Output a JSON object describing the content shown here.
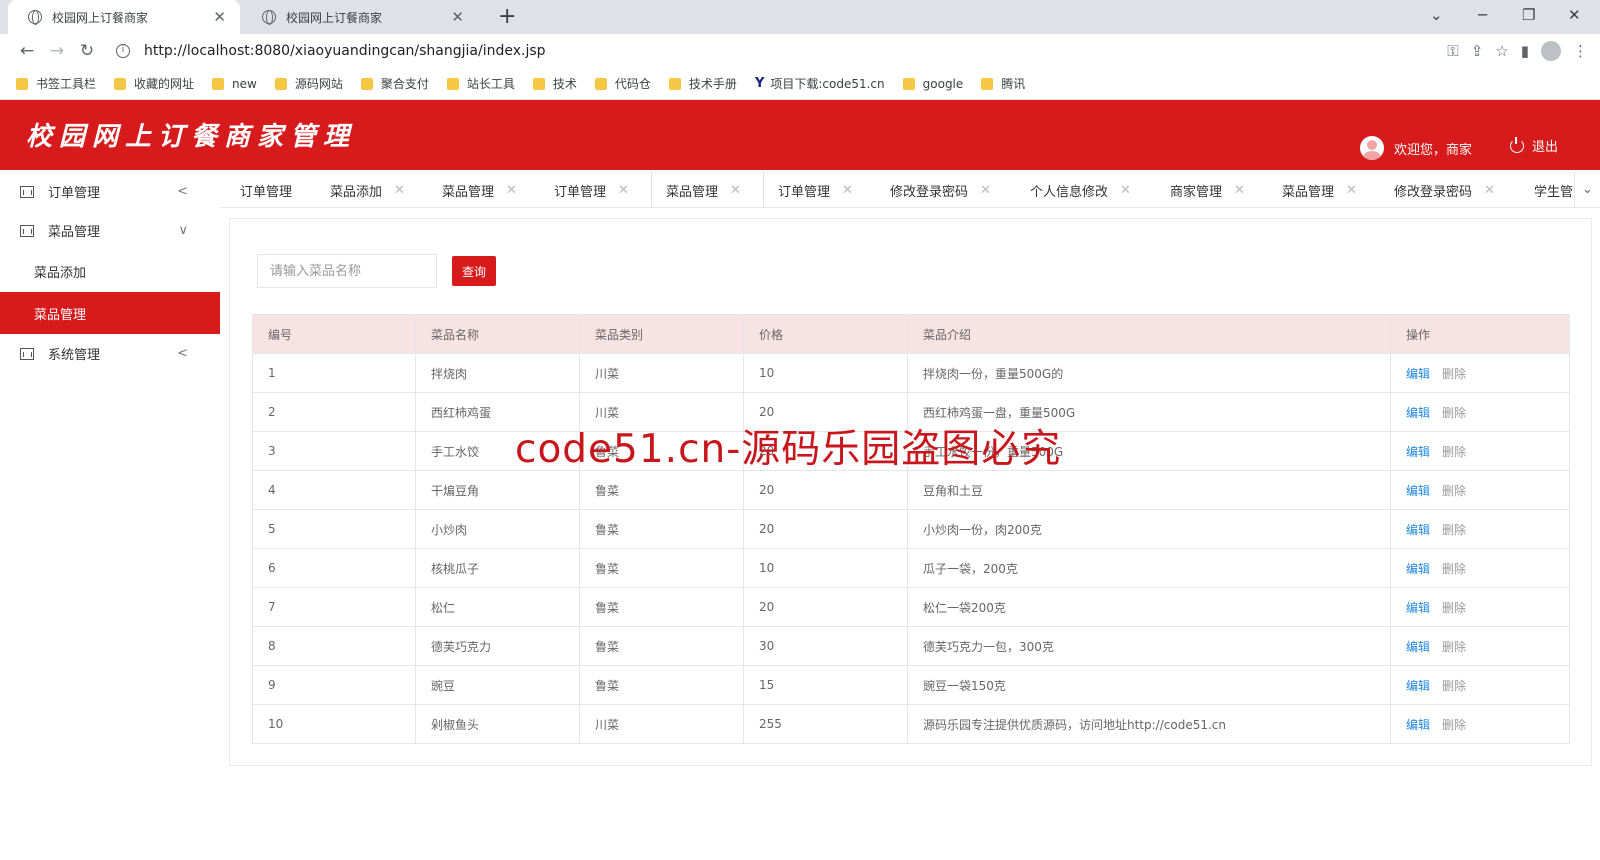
{
  "browser": {
    "tabs": [
      {
        "title": "校园网上订餐商家",
        "close": "✕"
      },
      {
        "title": "校园网上订餐商家",
        "close": "✕"
      }
    ],
    "new_tab": "+",
    "url": "http://localhost:8080/xiaoyuandingcan/shangjia/index.jsp",
    "bookmarks": [
      "书签工具栏",
      "收藏的网址",
      "new",
      "源码网站",
      "聚合支付",
      "站长工具",
      "技术",
      "代码仓",
      "技术手册",
      "项目下载:code51.cn",
      "google",
      "腾讯"
    ]
  },
  "header": {
    "title": "校园网上订餐商家管理",
    "welcome": "欢迎您，商家",
    "logout": "退出"
  },
  "sidebar": {
    "items": [
      {
        "label": "订单管理",
        "chevron": "<"
      },
      {
        "label": "菜品管理",
        "chevron": "∨",
        "children": [
          "菜品添加",
          "菜品管理"
        ]
      },
      {
        "label": "系统管理",
        "chevron": "<"
      }
    ]
  },
  "navtabs": [
    "订单管理",
    "菜品添加",
    "菜品管理",
    "订单管理",
    "菜品管理",
    "订单管理",
    "修改登录密码",
    "个人信息修改",
    "商家管理",
    "菜品管理",
    "修改登录密码",
    "学生管"
  ],
  "search": {
    "placeholder": "请输入菜品名称",
    "button": "查询"
  },
  "table": {
    "headers": [
      "编号",
      "菜品名称",
      "菜品类别",
      "价格",
      "菜品介绍",
      "操作"
    ],
    "edit_label": "编辑",
    "delete_label": "删除",
    "rows": [
      [
        "1",
        "拌烧肉",
        "川菜",
        "10",
        "拌烧肉一份，重量500G的"
      ],
      [
        "2",
        "西红柿鸡蛋",
        "川菜",
        "20",
        "西红柿鸡蛋一盘，重量500G"
      ],
      [
        "3",
        "手工水饺",
        "鲁菜",
        "20",
        "手工水饺一份，重量500G"
      ],
      [
        "4",
        "干煸豆角",
        "鲁菜",
        "20",
        "豆角和土豆"
      ],
      [
        "5",
        "小炒肉",
        "鲁菜",
        "20",
        "小炒肉一份，肉200克"
      ],
      [
        "6",
        "核桃瓜子",
        "鲁菜",
        "10",
        "瓜子一袋，200克"
      ],
      [
        "7",
        "松仁",
        "鲁菜",
        "20",
        "松仁一袋200克"
      ],
      [
        "8",
        "德芙巧克力",
        "鲁菜",
        "30",
        "德芙巧克力一包，300克"
      ],
      [
        "9",
        "豌豆",
        "鲁菜",
        "15",
        "豌豆一袋150克"
      ],
      [
        "10",
        "剁椒鱼头",
        "川菜",
        "255",
        "源码乐园专注提供优质源码，访问地址http://code51.cn"
      ]
    ]
  },
  "watermark": "code51.cn-源码乐园盗图必究"
}
